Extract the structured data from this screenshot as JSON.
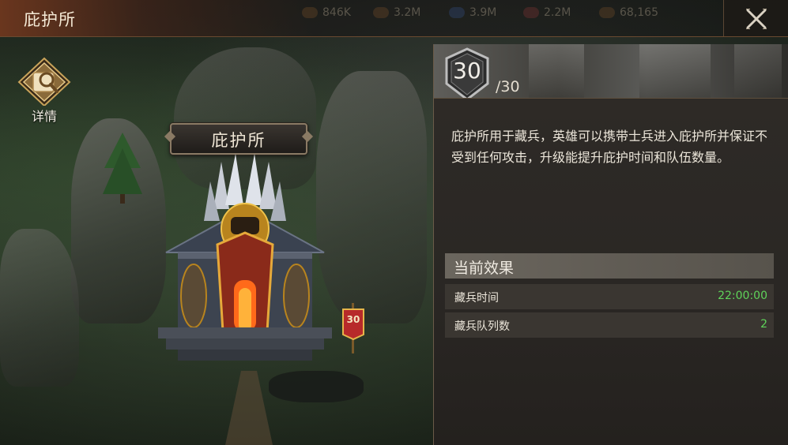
{
  "window": {
    "title": "庇护所"
  },
  "resources_faint": [
    "846K",
    "3.2M",
    "3.9M",
    "2.2M",
    "68,165"
  ],
  "detail_button": {
    "label": "详情",
    "icon": "magnifier-scroll-icon"
  },
  "building": {
    "name": "庇护所",
    "level_flag": "30"
  },
  "panel": {
    "level": "30",
    "max_level": "/30",
    "description": "庇护所用于藏兵，英雄可以携带士兵进入庇护所并保证不受到任何攻击，升级能提升庇护时间和队伍数量。",
    "effects_title": "当前效果",
    "effects": [
      {
        "label": "藏兵时间",
        "value": "22:00:00"
      },
      {
        "label": "藏兵队列数",
        "value": "2"
      }
    ]
  },
  "colors": {
    "accent_green": "#5fd45a",
    "title_bar": "#6e371e"
  }
}
